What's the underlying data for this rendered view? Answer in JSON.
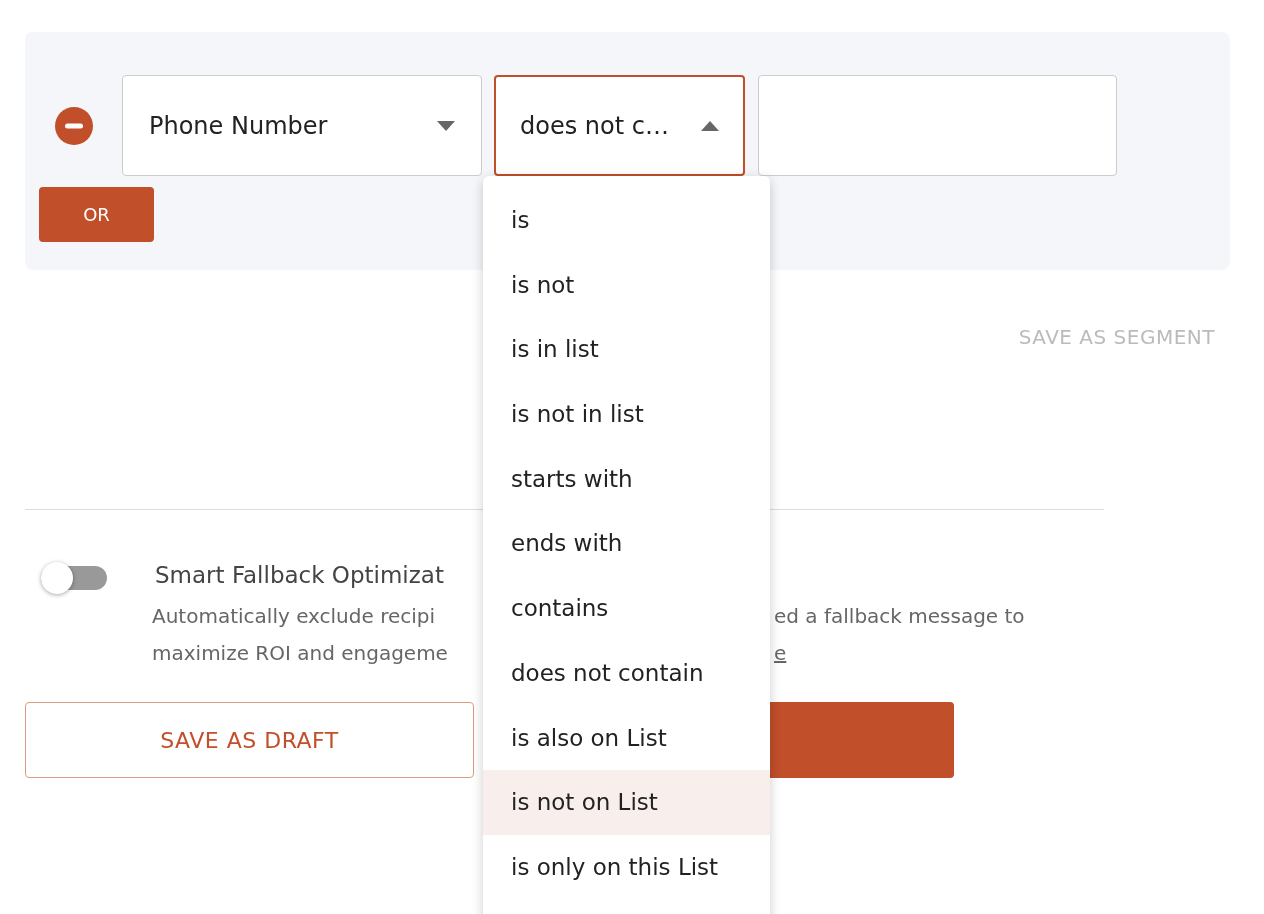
{
  "filter_rule": {
    "field": {
      "value": "Phone Number",
      "expanded": false
    },
    "operator": {
      "value": "does not c…",
      "expanded": true
    },
    "or_button": "OR"
  },
  "save_as_segment": "SAVE AS SEGMENT",
  "smart_fallback": {
    "on": false,
    "title": "Smart Fallback Optimizat",
    "description_left": [
      "Automatically exclude recipi",
      "maximize ROI and engageme"
    ],
    "description_right": [
      "ed a fallback message to"
    ],
    "link_fragment": "e"
  },
  "buttons": {
    "save_as_draft": "SAVE AS DRAFT"
  },
  "operator_menu": [
    {
      "label": "is",
      "selected": false
    },
    {
      "label": "is not",
      "selected": false
    },
    {
      "label": "is in list",
      "selected": false
    },
    {
      "label": "is not in list",
      "selected": false
    },
    {
      "label": "starts with",
      "selected": false
    },
    {
      "label": "ends with",
      "selected": false
    },
    {
      "label": "contains",
      "selected": false
    },
    {
      "label": "does not contain",
      "selected": false
    },
    {
      "label": "is also on List",
      "selected": false
    },
    {
      "label": "is not on List",
      "selected": true
    },
    {
      "label": "is only on this List",
      "selected": false
    }
  ]
}
